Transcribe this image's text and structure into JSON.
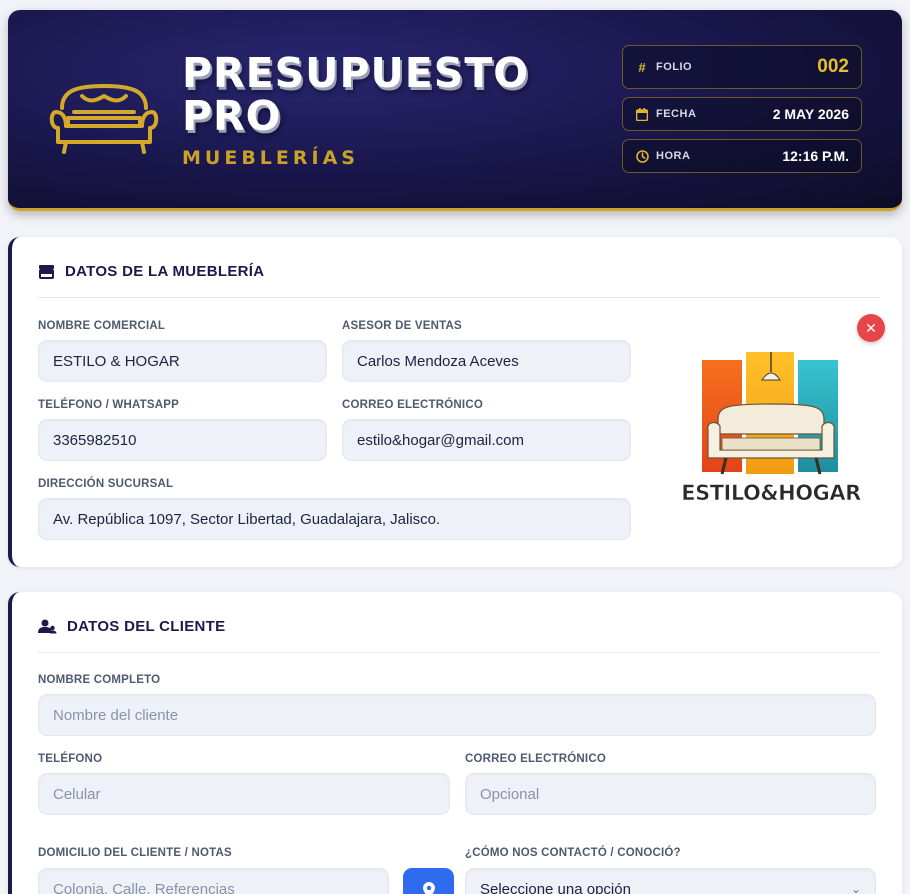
{
  "header": {
    "title_line1": "PRESUPUESTO",
    "title_line2": "PRO",
    "subtitle": "MUEBLERÍAS",
    "folio_label": "FOLIO",
    "folio_value": "002",
    "fecha_label": "FECHA",
    "fecha_value": "2 MAY 2026",
    "hora_label": "HORA",
    "hora_value": "12:16 P.M.",
    "icons": {
      "logo": "sofa-icon",
      "folio": "hash-icon",
      "fecha": "calendar-icon",
      "hora": "clock-icon"
    },
    "accent_color": "#c9a227"
  },
  "store": {
    "section_title": "DATOS DE LA MUEBLERÍA",
    "section_icon": "store-icon",
    "nombre_label": "NOMBRE COMERCIAL",
    "nombre_value": "ESTILO & HOGAR",
    "asesor_label": "ASESOR DE VENTAS",
    "asesor_value": "Carlos Mendoza Aceves",
    "telefono_label": "TELÉFONO / WHATSAPP",
    "telefono_value": "3365982510",
    "correo_label": "CORREO ELECTRÓNICO",
    "correo_value": "estilo&hogar@gmail.com",
    "direccion_label": "DIRECCIÓN SUCURSAL",
    "direccion_value": "Av. República 1097, Sector Libertad, Guadalajara, Jalisco.",
    "logo_text": "ESTILO&HOGAR",
    "remove_icon": "close-icon"
  },
  "client": {
    "section_title": "DATOS DEL CLIENTE",
    "section_icon": "users-icon",
    "nombre_label": "NOMBRE COMPLETO",
    "nombre_placeholder": "Nombre del cliente",
    "telefono_label": "TELÉFONO",
    "telefono_placeholder": "Celular",
    "correo_label": "CORREO ELECTRÓNICO",
    "correo_placeholder": "Opcional",
    "domicilio_label": "DOMICILIO DEL CLIENTE / NOTAS",
    "domicilio_placeholder": "Colonia, Calle, Referencias",
    "contacto_label": "¿CÓMO NOS CONTACTÓ / CONOCIÓ?",
    "contacto_value": "Seleccione una opción",
    "map_icon": "map-pin-icon"
  }
}
